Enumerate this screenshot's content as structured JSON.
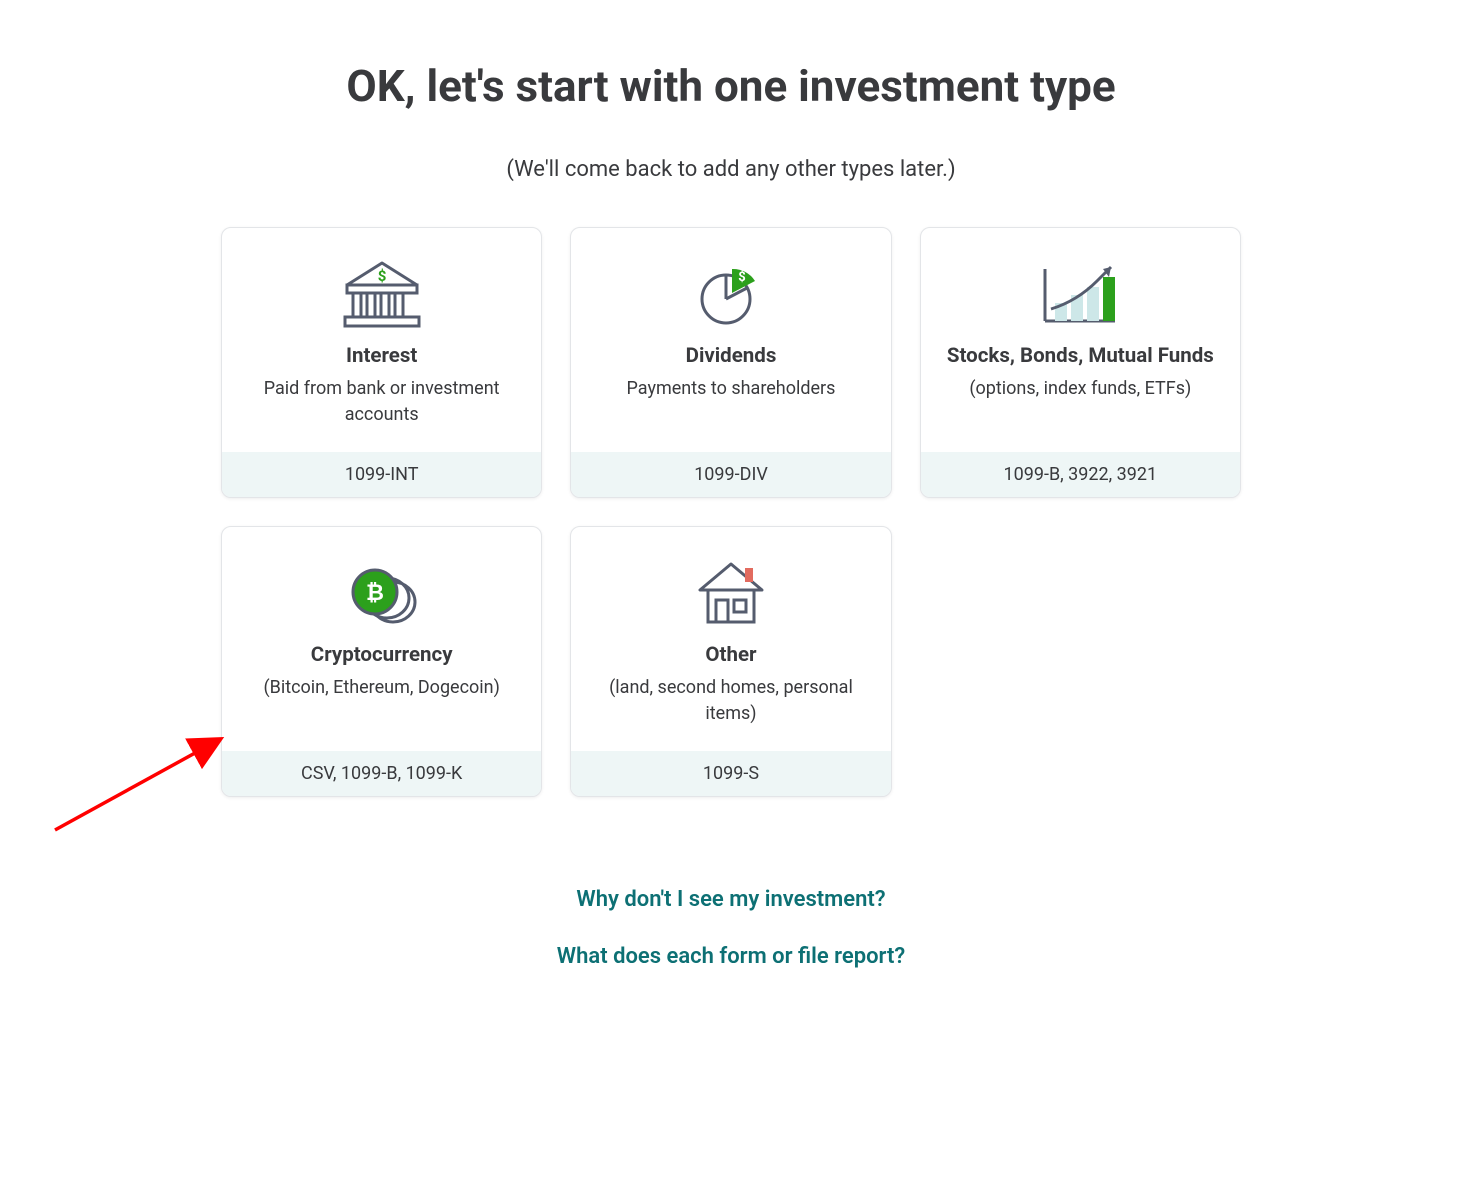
{
  "header": {
    "title": "OK, let's start with one investment type",
    "subtitle": "(We'll come back to add any other types later.)"
  },
  "cards": [
    {
      "title": "Interest",
      "desc": "Paid from bank or investment accounts",
      "footer": "1099-INT"
    },
    {
      "title": "Dividends",
      "desc": "Payments to shareholders",
      "footer": "1099-DIV"
    },
    {
      "title": "Stocks, Bonds, Mutual Funds",
      "desc": "(options, index funds, ETFs)",
      "footer": "1099-B, 3922, 3921"
    },
    {
      "title": "Cryptocurrency",
      "desc": "(Bitcoin, Ethereum, Dogecoin)",
      "footer": "CSV, 1099-B, 1099-K"
    },
    {
      "title": "Other",
      "desc": "(land, second homes, personal items)",
      "footer": "1099-S"
    }
  ],
  "help": {
    "link1": "Why don't I see my investment?",
    "link2": "What does each form or file report?"
  }
}
